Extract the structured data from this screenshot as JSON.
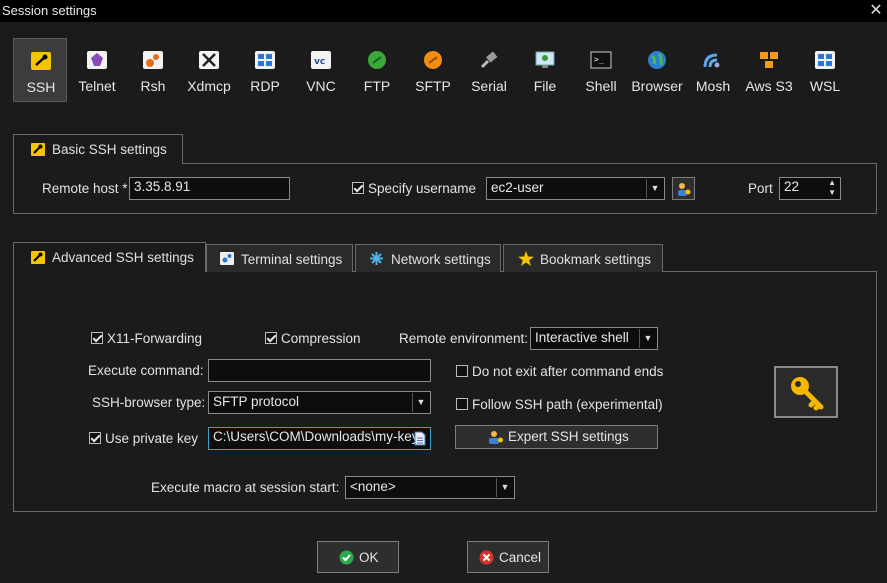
{
  "window": {
    "title": "Session settings",
    "close_glyph": "✕"
  },
  "protocols": [
    {
      "label": "SSH",
      "icon": "ssh-icon",
      "selected": true
    },
    {
      "label": "Telnet",
      "icon": "telnet-icon"
    },
    {
      "label": "Rsh",
      "icon": "rsh-icon"
    },
    {
      "label": "Xdmcp",
      "icon": "xdmcp-icon"
    },
    {
      "label": "RDP",
      "icon": "rdp-icon"
    },
    {
      "label": "VNC",
      "icon": "vnc-icon"
    },
    {
      "label": "FTP",
      "icon": "ftp-icon"
    },
    {
      "label": "SFTP",
      "icon": "sftp-icon"
    },
    {
      "label": "Serial",
      "icon": "serial-icon"
    },
    {
      "label": "File",
      "icon": "file-icon"
    },
    {
      "label": "Shell",
      "icon": "shell-icon"
    },
    {
      "label": "Browser",
      "icon": "browser-icon"
    },
    {
      "label": "Mosh",
      "icon": "mosh-icon"
    },
    {
      "label": "Aws S3",
      "icon": "aws-s3-icon"
    },
    {
      "label": "WSL",
      "icon": "wsl-icon"
    }
  ],
  "basic": {
    "tab_label": "Basic SSH settings",
    "remote_host_label": "Remote host *",
    "remote_host_value": "3.35.8.91",
    "specify_username_label": "Specify username",
    "specify_username_checked": true,
    "username_value": "ec2-user",
    "port_label": "Port",
    "port_value": "22"
  },
  "tabs": [
    {
      "label": "Advanced SSH settings",
      "icon": "wrench-icon",
      "active": true
    },
    {
      "label": "Terminal settings",
      "icon": "terminal-icon"
    },
    {
      "label": "Network settings",
      "icon": "network-icon"
    },
    {
      "label": "Bookmark settings",
      "icon": "star-icon"
    }
  ],
  "advanced": {
    "x11_label": "X11-Forwarding",
    "x11_checked": true,
    "compression_label": "Compression",
    "compression_checked": true,
    "remote_env_label": "Remote environment:",
    "remote_env_value": "Interactive shell",
    "exec_cmd_label": "Execute command:",
    "exec_cmd_value": "",
    "no_exit_label": "Do not exit after command ends",
    "no_exit_checked": false,
    "browser_type_label": "SSH-browser type:",
    "browser_type_value": "SFTP protocol",
    "follow_path_label": "Follow SSH path (experimental)",
    "follow_path_checked": false,
    "private_key_label": "Use private key",
    "private_key_checked": true,
    "private_key_value": "C:\\Users\\COM\\Downloads\\my-key",
    "expert_button": "Expert SSH settings",
    "macro_label": "Execute macro at session start:",
    "macro_value": "<none>"
  },
  "footer": {
    "ok_label": "OK",
    "cancel_label": "Cancel"
  },
  "colors": {
    "accent_yellow": "#f5c400",
    "ok_green": "#2fa84f",
    "cancel_red": "#d9342b"
  }
}
